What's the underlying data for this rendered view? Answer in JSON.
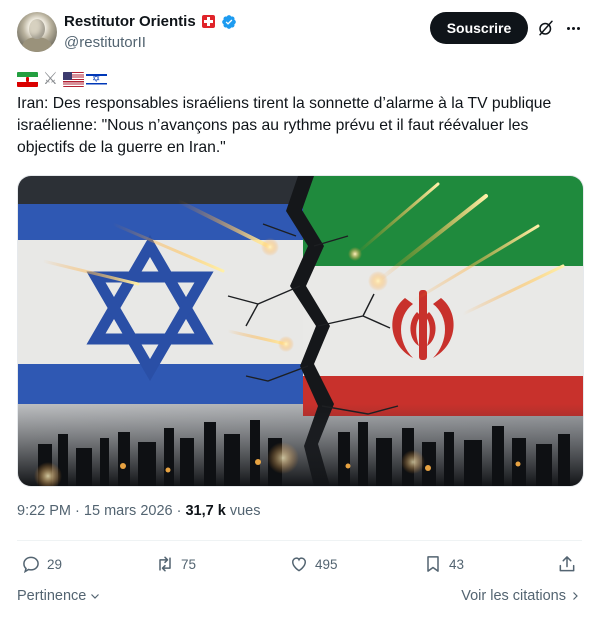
{
  "author": {
    "name": "Restitutor Orientis",
    "handle": "@restitutorII",
    "verified": true,
    "badge": "swiss-flag"
  },
  "header": {
    "subscribe_label": "Souscrire"
  },
  "tweet": {
    "flags": [
      "iran-flag",
      "crossed-swords",
      "us-flag",
      "israel-flag"
    ],
    "text": "Iran: Des responsables israéliens tirent la sonnette d’alarme à la TV publique israélienne: \"Nous n’avançons pas au rythme prévu et il faut réévaluer les objectifs de la guerre en Iran.\"",
    "image": "Israeli flag and Iranian flag split by a crack, missiles and burning city skyline"
  },
  "meta": {
    "time": "9:22 PM",
    "separator": "·",
    "date": "15 mars 2026",
    "separator2": "·",
    "views_count": "31,7 k",
    "views_label": "vues"
  },
  "actions": {
    "replies": "29",
    "reposts": "75",
    "likes": "495",
    "bookmarks": "43"
  },
  "footer": {
    "sort_label": "Pertinence",
    "quotes_label": "Voir les citations"
  },
  "colors": {
    "text": "#0f1419",
    "muted": "#536471",
    "verified": "#1d9bf0",
    "button": "#0f1419"
  }
}
